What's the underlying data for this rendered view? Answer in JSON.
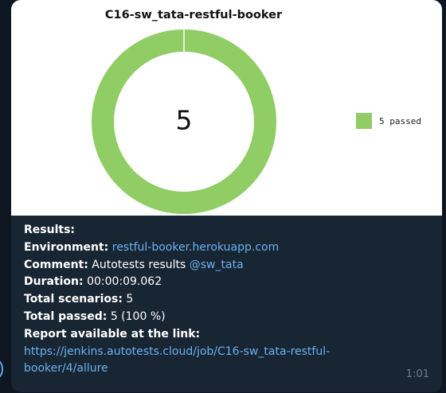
{
  "chart": {
    "title": "C16-sw_tata-restful-booker",
    "center_value": "5",
    "legend_label": "5 passed",
    "passed_color": "#90cd65",
    "background_color": "#ffffff"
  },
  "chart_data": {
    "type": "pie",
    "title": "C16-sw_tata-restful-booker",
    "categories": [
      "5 passed"
    ],
    "values": [
      5
    ],
    "colors": [
      "#90cd65"
    ],
    "center_text": "5",
    "legend_position": "right"
  },
  "message": {
    "results_label": "Results:",
    "environment_label": "Environment:",
    "environment_link": "restful-booker.herokuapp.com",
    "comment_label": "Comment:",
    "comment_text": " Autotests results ",
    "comment_mention": "@sw_tata",
    "duration_label": "Duration:",
    "duration_value": " 00:00:09.062",
    "total_scenarios_label": "Total scenarios:",
    "total_scenarios_value": " 5",
    "total_passed_label": "Total passed:",
    "total_passed_value": " 5 (100 %)",
    "report_label": "Report available at the link:",
    "report_url": "https://jenkins.autotests.cloud/job/C16-sw_tata-restful-booker/4/allure",
    "time": "1:01"
  },
  "colors": {
    "app_background": "#0e1621",
    "bubble_background": "#182533",
    "link": "#6ab2f2",
    "timestamp": "#6d7f8f"
  }
}
